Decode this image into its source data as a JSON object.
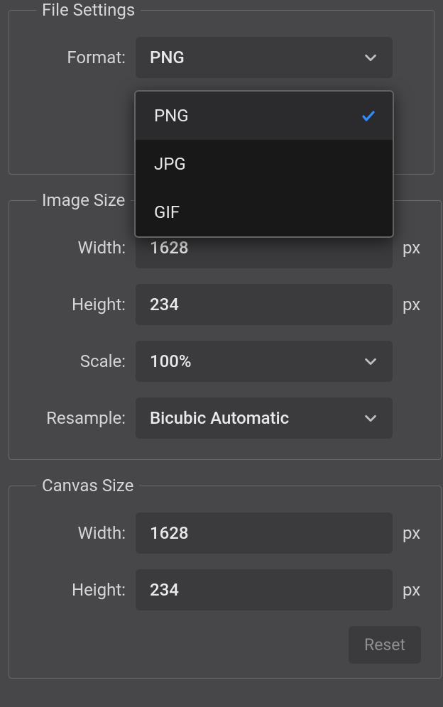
{
  "file_settings": {
    "legend": "File Settings",
    "format_label": "Format:",
    "format_value": "PNG",
    "dropdown": {
      "options": [
        "PNG",
        "JPG",
        "GIF"
      ],
      "selected": "PNG"
    }
  },
  "image_size": {
    "legend": "Image Size",
    "width_label": "Width:",
    "width_value": "1628",
    "width_unit": "px",
    "height_label": "Height:",
    "height_value": "234",
    "height_unit": "px",
    "scale_label": "Scale:",
    "scale_value": "100%",
    "resample_label": "Resample:",
    "resample_value": "Bicubic Automatic"
  },
  "canvas_size": {
    "legend": "Canvas Size",
    "width_label": "Width:",
    "width_value": "1628",
    "width_unit": "px",
    "height_label": "Height:",
    "height_value": "234",
    "height_unit": "px",
    "reset_label": "Reset"
  }
}
